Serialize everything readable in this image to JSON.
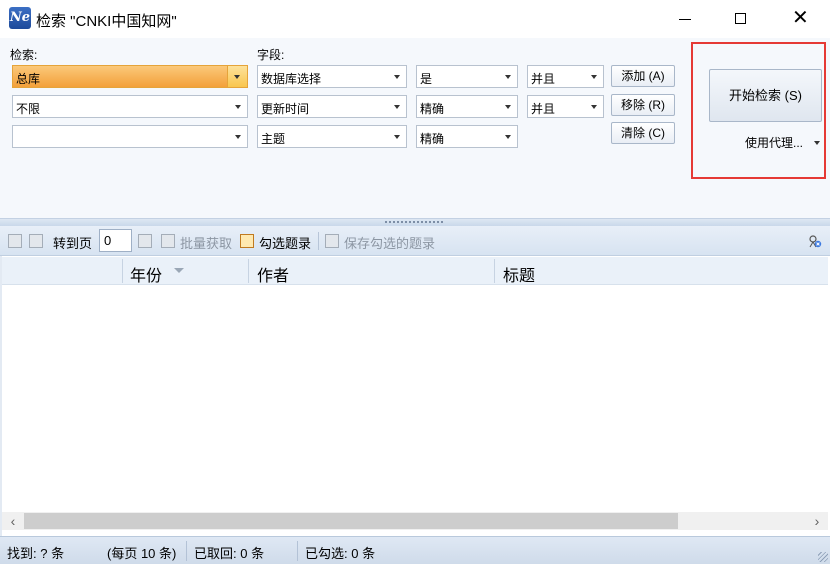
{
  "window": {
    "title": "检索 \"CNKI中国知网\"",
    "app_icon_text": "Ne",
    "minimize_glyph": "—",
    "maximize_glyph": "□",
    "close_glyph": "✕"
  },
  "search": {
    "search_label": "检索:",
    "field_label": "字段:",
    "rows": [
      {
        "term": "总库",
        "field": "数据库选择",
        "match": "是",
        "logic": "并且"
      },
      {
        "term": "不限",
        "field": "更新时间",
        "match": "精确",
        "logic": "并且"
      },
      {
        "term": "",
        "field": "主题",
        "match": "精确"
      }
    ],
    "add_label": "添加 (A)",
    "remove_label": "移除 (R)",
    "clear_label": "清除 (C)",
    "start_label": "开始检索 (S)",
    "proxy_label": "使用代理..."
  },
  "toolbar": {
    "goto_label": "转到页",
    "page_value": "0",
    "batch_label": "批量获取",
    "check_label": "勾选题录",
    "save_label": "保存勾选的题录"
  },
  "columns": [
    "年份",
    "作者",
    "标题"
  ],
  "status": {
    "found": "找到: ? 条",
    "per_page": "(每页 10 条)",
    "fetched": "已取回: 0 条",
    "checked": "已勾选: 0 条"
  },
  "colors": {
    "highlight_border": "#e53935",
    "selected_combo": "#f3a03a",
    "panel_bg": "#f5f8fc"
  }
}
